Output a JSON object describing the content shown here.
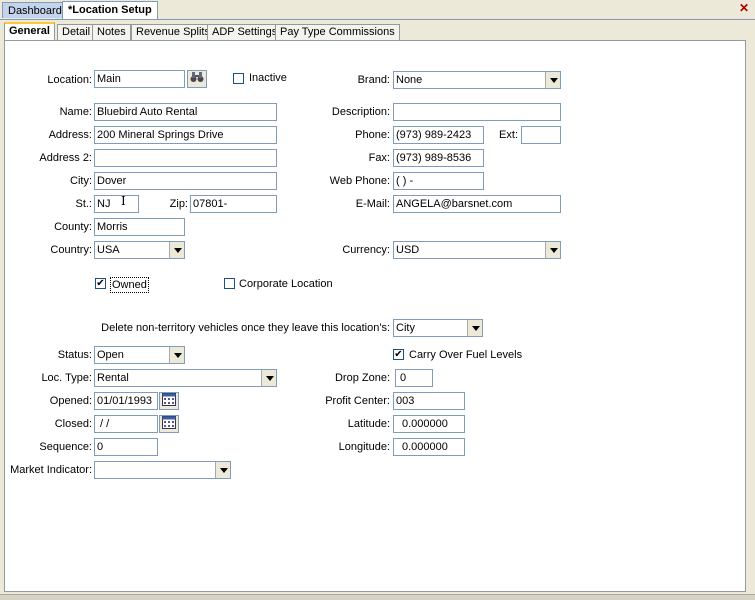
{
  "doc_tabs": [
    {
      "label": "Dashboard"
    },
    {
      "label": "*Location Setup"
    }
  ],
  "sub_tabs": [
    {
      "label": "General"
    },
    {
      "label": "Detail"
    },
    {
      "label": "Notes"
    },
    {
      "label": "Revenue Splits"
    },
    {
      "label": "ADP Settings"
    },
    {
      "label": "Pay Type Commissions"
    }
  ],
  "form": {
    "location": {
      "label": "Location:",
      "value": "Main"
    },
    "inactive": {
      "label": "Inactive",
      "checked": false
    },
    "brand": {
      "label": "Brand:",
      "value": "None"
    },
    "name": {
      "label": "Name:",
      "value": "Bluebird Auto Rental"
    },
    "description": {
      "label": "Description:",
      "value": ""
    },
    "address": {
      "label": "Address:",
      "value": "200 Mineral Springs Drive"
    },
    "phone": {
      "label": "Phone:",
      "value": "(973) 989-2423"
    },
    "ext": {
      "label": "Ext:",
      "value": ""
    },
    "address2": {
      "label": "Address 2:",
      "value": ""
    },
    "fax": {
      "label": "Fax:",
      "value": "(973) 989-8536"
    },
    "city": {
      "label": "City:",
      "value": "Dover"
    },
    "web_phone": {
      "label": "Web Phone:",
      "value": "(   )    -"
    },
    "state": {
      "label": "St.:",
      "value": "NJ"
    },
    "zip": {
      "label": "Zip:",
      "value": "07801-"
    },
    "email": {
      "label": "E-Mail:",
      "value": "ANGELA@barsnet.com"
    },
    "county": {
      "label": "County:",
      "value": "Morris"
    },
    "country": {
      "label": "Country:",
      "value": "USA"
    },
    "currency": {
      "label": "Currency:",
      "value": "USD"
    },
    "owned": {
      "label": "Owned",
      "checked": true
    },
    "corporate": {
      "label": "Corporate Location",
      "checked": false
    },
    "delete_nonterritory": {
      "label": "Delete non-territory vehicles once they leave this location's:",
      "value": "City"
    },
    "status": {
      "label": "Status:",
      "value": "Open"
    },
    "carry_over": {
      "label": "Carry Over Fuel Levels",
      "checked": true
    },
    "loc_type": {
      "label": "Loc. Type:",
      "value": "Rental"
    },
    "drop_zone": {
      "label": "Drop Zone:",
      "value": "0"
    },
    "opened": {
      "label": "Opened:",
      "value": "01/01/1993"
    },
    "profit_center": {
      "label": "Profit Center:",
      "value": "003"
    },
    "closed": {
      "label": "Closed:",
      "value": " /  /"
    },
    "latitude": {
      "label": "Latitude:",
      "value": "0.000000"
    },
    "sequence": {
      "label": "Sequence:",
      "value": "0"
    },
    "longitude": {
      "label": "Longitude:",
      "value": "0.000000"
    },
    "market_indicator": {
      "label": "Market Indicator:",
      "value": ""
    }
  },
  "icons": {
    "close": "close-icon",
    "search": "binoculars-icon",
    "calendar": "calendar-icon"
  },
  "colors": {
    "tab_bar": "#c5d3ec",
    "active_tab_accent": "#ffc83c",
    "border": "#7f9db9"
  }
}
